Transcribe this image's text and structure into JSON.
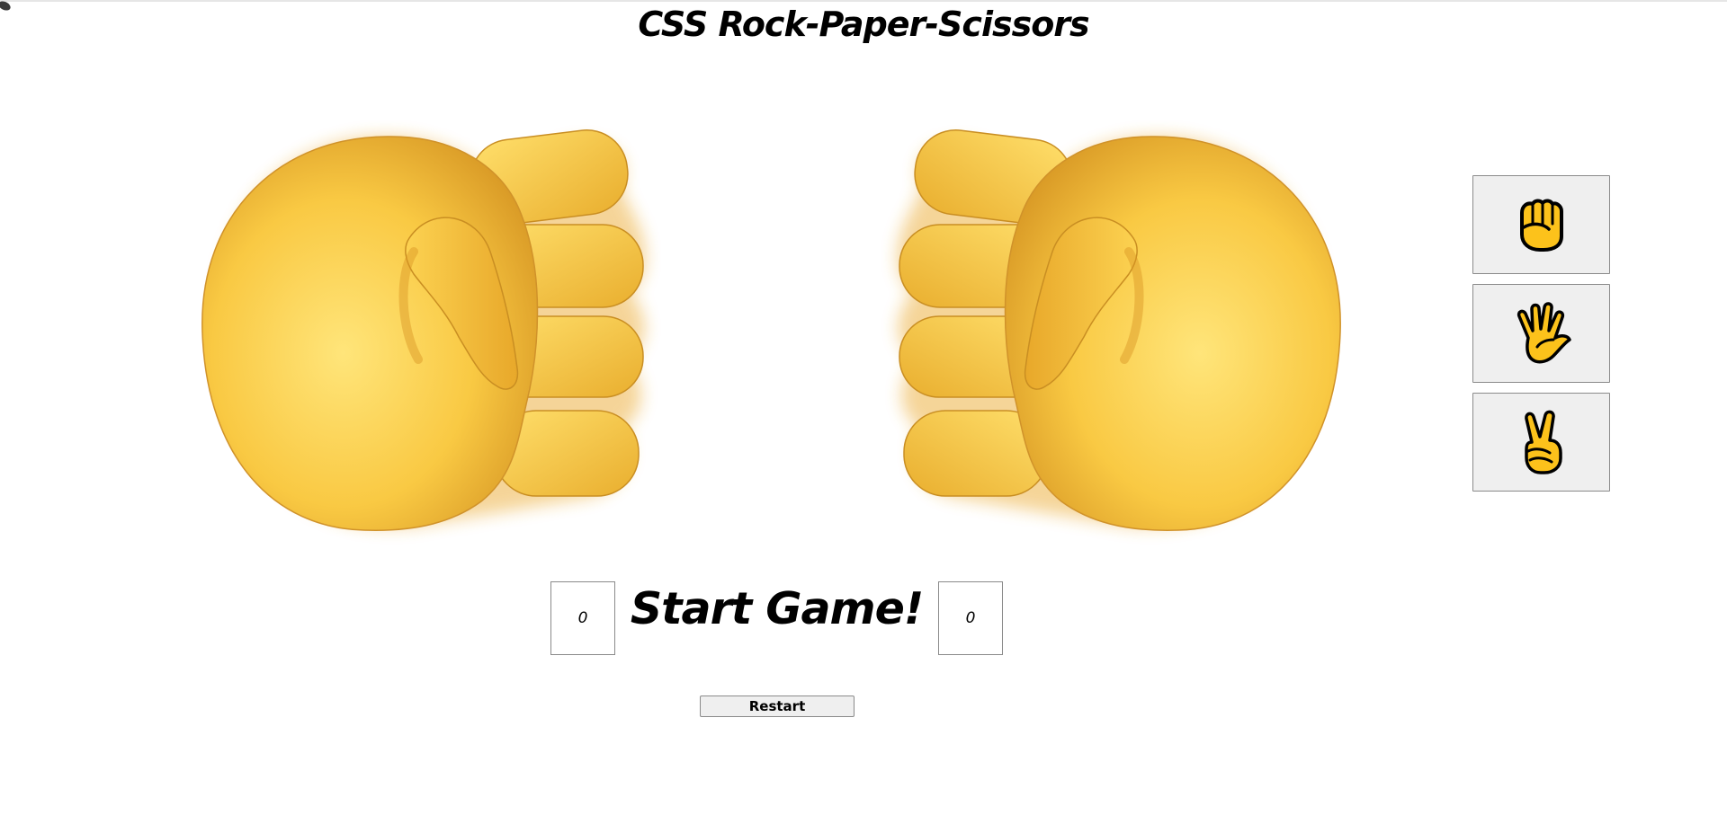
{
  "title": "CSS Rock-Paper-Scissors",
  "player": {
    "hand": "fist-icon",
    "score": "0"
  },
  "computer": {
    "hand": "fist-icon",
    "score": "0"
  },
  "status": "Start Game!",
  "choices": [
    {
      "id": "rock",
      "icon": "raised-fist-icon"
    },
    {
      "id": "paper",
      "icon": "raised-hand-fingers-splayed-icon"
    },
    {
      "id": "scissors",
      "icon": "victory-hand-icon"
    }
  ],
  "restart_label": "Restart",
  "colors": {
    "skin_light": "#FFE070",
    "skin_mid": "#F7C63E",
    "skin_dark": "#C8871C",
    "icon_fill": "#FCC21B",
    "button_bg": "#EFEFEF",
    "button_border": "#8A8A8A"
  }
}
